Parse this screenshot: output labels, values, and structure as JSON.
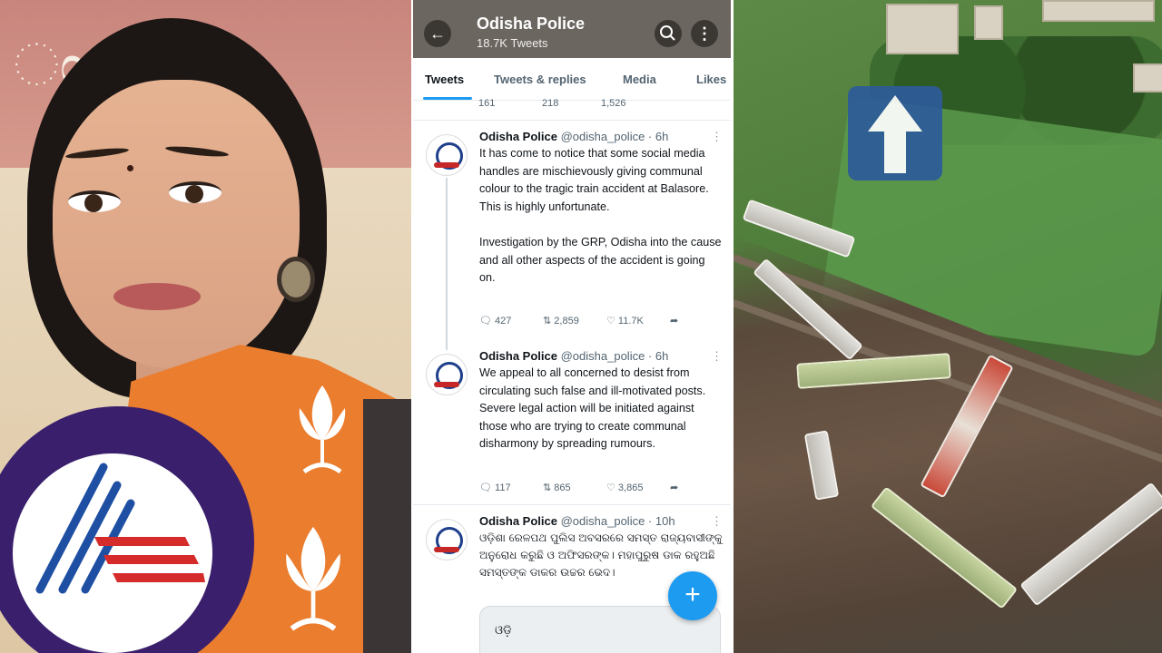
{
  "left_panel": {
    "banner_text": "ಂ ಳೂ",
    "logo_name": "suvarna-news-logo"
  },
  "twitter": {
    "header": {
      "name": "Odisha Police",
      "tweet_count": "18.7K Tweets"
    },
    "tabs": [
      "Tweets",
      "Tweets & replies",
      "Media",
      "Likes"
    ],
    "active_tab": "Tweets",
    "partial_stats": {
      "replies": "161",
      "retweets": "218",
      "likes": "1,526"
    },
    "tweets": [
      {
        "name": "Odisha Police",
        "handle": "@odisha_police · 6h",
        "text": "It has come to notice that some social media handles are mischievously giving communal colour to the tragic train accident at Balasore. This is highly unfortunate.\n\n     Investigation by the GRP, Odisha into the cause and all other aspects of the accident is going on.",
        "replies": "427",
        "retweets": "2,859",
        "likes": "11.7K"
      },
      {
        "name": "Odisha Police",
        "handle": "@odisha_police · 6h",
        "text": "We appeal to all concerned to desist from circulating such false and ill-motivated posts. Severe legal action will be initiated against those who are trying to create communal disharmony by spreading rumours.",
        "replies": "117",
        "retweets": "865",
        "likes": "3,865"
      },
      {
        "name": "Odisha Police",
        "handle": "@odisha_police · 10h",
        "text": "ଓଡ଼ିଶା ରେଳପଥ ପୁଲିସ ଅବସରରେ ସମସ୍ତ ରାଜ୍ୟବାସୀଙ୍କୁ ଅନୁରୋଧ କରୁଛି ଓ ଅଫିସରଙ୍କ। ମହାପୁରୁଷ ଡାକ ରହୁଅଛି ସମସ୍ତଙ୍କ ଡାକର ଉଚ୍ଚର ଭେଦ।",
        "media_text": "ଓଡ଼ି"
      }
    ],
    "fab_label": "+"
  },
  "colors": {
    "twitter_blue": "#1d9bf0",
    "logo_ring": "#3a1f6d",
    "saree": "#eb7d2e"
  }
}
